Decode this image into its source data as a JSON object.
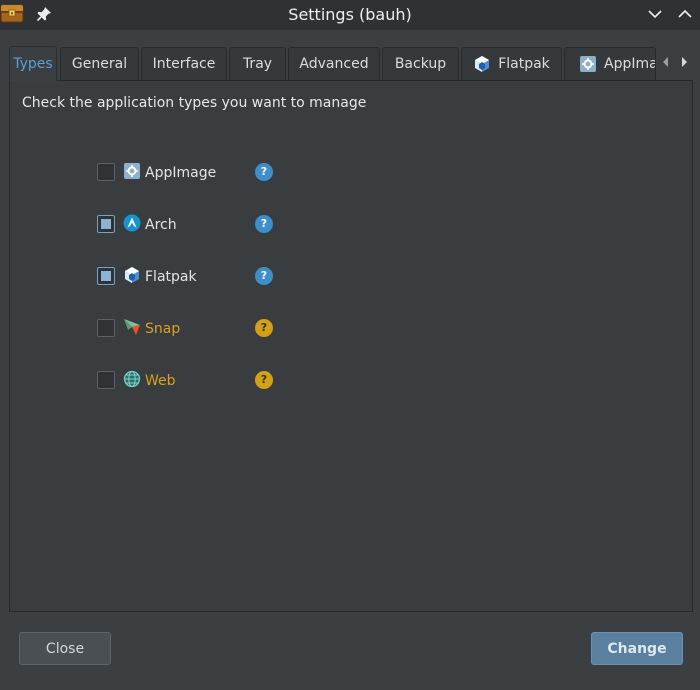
{
  "window": {
    "title": "Settings (bauh)"
  },
  "tabs": [
    {
      "label": "Types",
      "active": true
    },
    {
      "label": "General"
    },
    {
      "label": "Interface"
    },
    {
      "label": "Tray"
    },
    {
      "label": "Advanced"
    },
    {
      "label": "Backup"
    },
    {
      "label": "Flatpak",
      "icon": "flatpak-icon"
    },
    {
      "label": "AppImag",
      "icon": "appimage-icon"
    }
  ],
  "types_panel": {
    "instruction": "Check the application types you want to manage",
    "items": [
      {
        "label": "AppImage",
        "checked": false,
        "icon": "appimage-icon",
        "help_color": "#3d8ec9",
        "help": "?"
      },
      {
        "label": "Arch",
        "checked": true,
        "icon": "arch-icon",
        "help_color": "#3d8ec9",
        "help": "?"
      },
      {
        "label": "Flatpak",
        "checked": true,
        "icon": "flatpak-icon",
        "help_color": "#3d8ec9",
        "help": "?"
      },
      {
        "label": "Snap",
        "checked": false,
        "icon": "snap-icon",
        "label_color": "#d7a21e",
        "help_color": "#d3a118",
        "help": "?"
      },
      {
        "label": "Web",
        "checked": false,
        "icon": "web-icon",
        "label_color": "#d7a21e",
        "help_color": "#d3a118",
        "help": "?"
      }
    ]
  },
  "buttons": {
    "close": "Close",
    "change": "Change"
  },
  "colors": {
    "accent": "#5a9fd4",
    "warning": "#d7a21e",
    "background": "#3b3f42"
  }
}
